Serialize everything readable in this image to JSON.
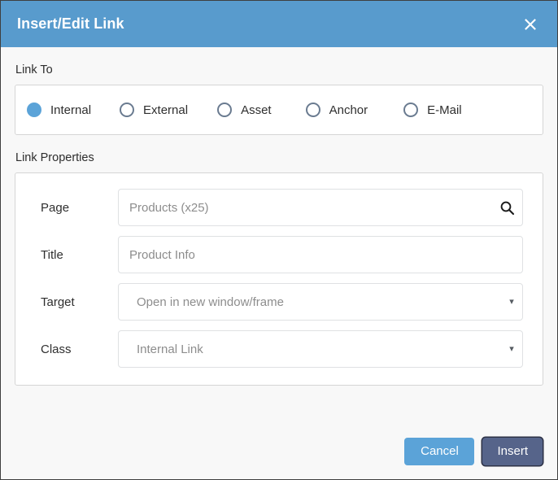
{
  "dialog": {
    "title": "Insert/Edit Link",
    "close_icon": "close-icon"
  },
  "link_to": {
    "section_label": "Link To",
    "options": [
      {
        "label": "Internal",
        "selected": true
      },
      {
        "label": "External",
        "selected": false
      },
      {
        "label": "Asset",
        "selected": false
      },
      {
        "label": "Anchor",
        "selected": false
      },
      {
        "label": "E-Mail",
        "selected": false
      }
    ]
  },
  "link_properties": {
    "section_label": "Link Properties",
    "fields": [
      {
        "label": "Page",
        "value": "Products (x25)",
        "type": "search",
        "icon": "search-icon"
      },
      {
        "label": "Title",
        "value": "Product Info",
        "type": "text"
      },
      {
        "label": "Target",
        "value": "Open in new window/frame",
        "type": "select",
        "caret": "▾"
      },
      {
        "label": "Class",
        "value": "Internal Link",
        "type": "select",
        "caret": "▾"
      }
    ]
  },
  "footer": {
    "cancel_label": "Cancel",
    "insert_label": "Insert"
  },
  "colors": {
    "header_blue": "#589bcd",
    "accent_blue": "#5ba3d8",
    "insert_slate": "#56648a",
    "body_bg": "#f8f8f8"
  }
}
